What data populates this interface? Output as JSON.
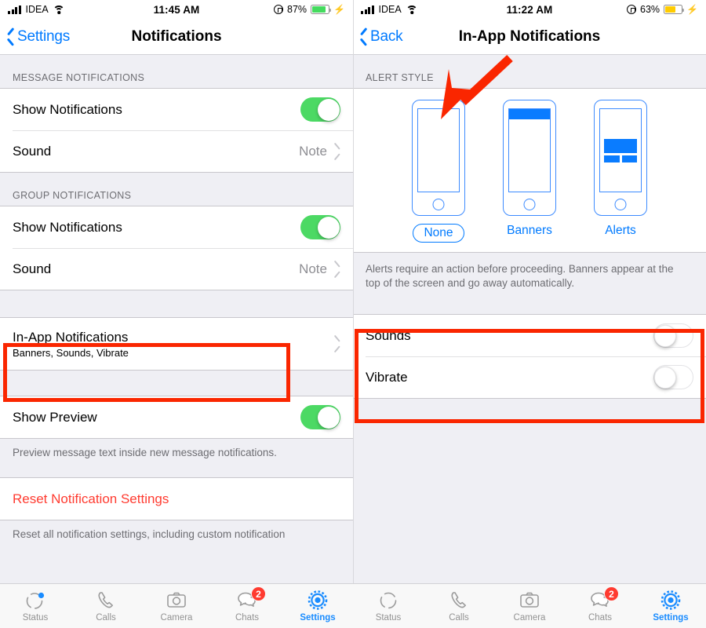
{
  "left": {
    "status_bar": {
      "carrier": "IDEA",
      "time": "11:45 AM",
      "battery_pct": "87%",
      "battery_level": 87,
      "battery_color": "#44DB5E",
      "signal_icon": "cellular-signal-icon",
      "wifi_icon": "wifi-icon",
      "rotation_lock_icon": "rotation-lock-icon",
      "charging_icon": "charging-bolt-icon"
    },
    "nav": {
      "back_label": "Settings",
      "title": "Notifications",
      "back_icon": "chevron-left-icon"
    },
    "sections": [
      {
        "header": "MESSAGE NOTIFICATIONS",
        "rows": [
          {
            "title": "Show Notifications",
            "type": "toggle",
            "value": "on"
          },
          {
            "title": "Sound",
            "type": "disclosure",
            "value": "Note"
          }
        ]
      },
      {
        "header": "GROUP NOTIFICATIONS",
        "rows": [
          {
            "title": "Show Notifications",
            "type": "toggle",
            "value": "on"
          },
          {
            "title": "Sound",
            "type": "disclosure",
            "value": "Note"
          }
        ]
      },
      {
        "header": "",
        "rows": [
          {
            "title": "In-App Notifications",
            "subtitle": "Banners, Sounds, Vibrate",
            "type": "disclosure",
            "value": ""
          }
        ]
      },
      {
        "header": "",
        "rows": [
          {
            "title": "Show Preview",
            "type": "toggle",
            "value": "on"
          }
        ],
        "footnote": "Preview message text inside new message notifications."
      },
      {
        "header": "",
        "rows": [
          {
            "title": "Reset Notification Settings",
            "type": "danger",
            "value": ""
          }
        ],
        "footnote": "Reset all notification settings, including custom notification"
      }
    ]
  },
  "right": {
    "status_bar": {
      "carrier": "IDEA",
      "time": "11:22 AM",
      "battery_pct": "63%",
      "battery_level": 63,
      "battery_color": "#FFCC00",
      "signal_icon": "cellular-signal-icon",
      "wifi_icon": "wifi-icon",
      "rotation_lock_icon": "rotation-lock-icon",
      "charging_icon": "charging-bolt-icon"
    },
    "nav": {
      "back_label": "Back",
      "title": "In-App Notifications",
      "back_icon": "chevron-left-icon"
    },
    "alert_style": {
      "header": "ALERT STYLE",
      "options": [
        {
          "label": "None",
          "selected": true,
          "preview": "blank"
        },
        {
          "label": "Banners",
          "selected": false,
          "preview": "banner"
        },
        {
          "label": "Alerts",
          "selected": false,
          "preview": "alert"
        }
      ],
      "footnote": "Alerts require an action before proceeding. Banners appear at the top of the screen and go away automatically."
    },
    "toggles": [
      {
        "title": "Sounds",
        "value": "off"
      },
      {
        "title": "Vibrate",
        "value": "off"
      }
    ]
  },
  "tabbar": {
    "left_tabs": [
      {
        "label": "Status",
        "icon": "status-ring-icon",
        "active": false,
        "dot": true,
        "badge": ""
      },
      {
        "label": "Calls",
        "icon": "phone-icon",
        "active": false,
        "dot": false,
        "badge": ""
      },
      {
        "label": "Camera",
        "icon": "camera-icon",
        "active": false,
        "dot": false,
        "badge": ""
      },
      {
        "label": "Chats",
        "icon": "chat-bubbles-icon",
        "active": false,
        "dot": false,
        "badge": "2"
      },
      {
        "label": "Settings",
        "icon": "gear-icon",
        "active": true,
        "dot": false,
        "badge": ""
      }
    ],
    "right_tabs": [
      {
        "label": "Status",
        "icon": "status-ring-icon",
        "active": false,
        "dot": false,
        "badge": ""
      },
      {
        "label": "Calls",
        "icon": "phone-icon",
        "active": false,
        "dot": false,
        "badge": ""
      },
      {
        "label": "Camera",
        "icon": "camera-icon",
        "active": false,
        "dot": false,
        "badge": ""
      },
      {
        "label": "Chats",
        "icon": "chat-bubbles-icon",
        "active": false,
        "dot": false,
        "badge": "2"
      },
      {
        "label": "Settings",
        "icon": "gear-icon",
        "active": true,
        "dot": false,
        "badge": ""
      }
    ]
  },
  "annotations": {
    "accent_red": "#FA2600",
    "highlight_left": "In-App Notifications row",
    "highlight_right": "Sounds and Vibrate rows",
    "arrow_target": "None alert style option"
  }
}
